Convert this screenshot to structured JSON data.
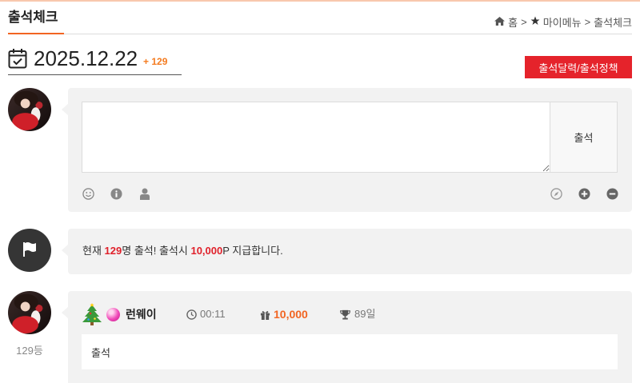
{
  "page": {
    "title": "출석체크",
    "breadcrumb": {
      "items": [
        {
          "label": "홈",
          "icon": "home-icon"
        },
        {
          "label": "마이메뉴",
          "icon": "star-icon"
        },
        {
          "label": "출석체크"
        }
      ],
      "separator": ">"
    }
  },
  "date_header": {
    "date": "2025.12.22",
    "count": "+ 129",
    "policy_button": "출석달력/출석정책"
  },
  "composer": {
    "value": "",
    "submit_label": "출석",
    "left_icons": [
      "smile-icon",
      "info-icon",
      "user-icon"
    ],
    "right_icons": [
      "compass-icon",
      "plus-circle-icon",
      "minus-circle-icon"
    ]
  },
  "notice": {
    "prefix": "현재 ",
    "count": "129",
    "middle": "명 출석! 출석시 ",
    "points": "10,000",
    "suffix": "P 지급합니다."
  },
  "entries": [
    {
      "rank": "129등",
      "nickname": "런웨이",
      "time": "00:11",
      "points": "10,000",
      "streak": "89일",
      "comment": "출석"
    }
  ],
  "theme": {
    "accent_orange": "#f26522",
    "button_red": "#e5232b",
    "highlight_red": "#e0212b",
    "panel_bg": "#f2f2f2"
  }
}
